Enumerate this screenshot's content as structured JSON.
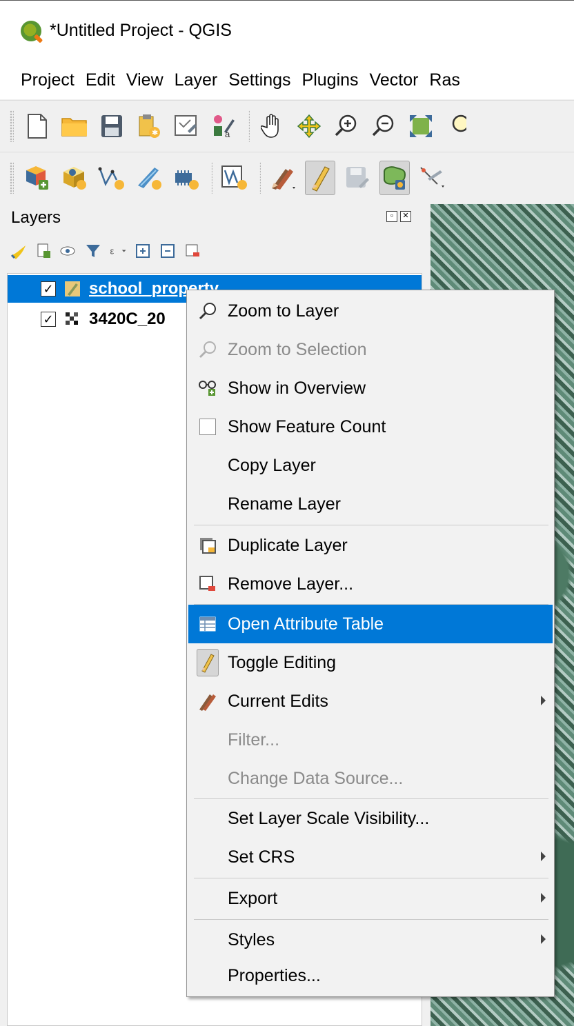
{
  "window": {
    "title": "*Untitled Project - QGIS"
  },
  "menubar": {
    "items": [
      "Project",
      "Edit",
      "View",
      "Layer",
      "Settings",
      "Plugins",
      "Vector",
      "Ras"
    ]
  },
  "layers_panel": {
    "title": "Layers",
    "layers": [
      {
        "name": "school_property",
        "checked": true,
        "selected": true
      },
      {
        "name": "3420C_20",
        "checked": true,
        "selected": false
      }
    ]
  },
  "context_menu": {
    "items": [
      {
        "label": "Zoom to Layer",
        "icon": "magnifier-icon"
      },
      {
        "label": "Zoom to Selection",
        "icon": "magnifier-icon",
        "disabled": true
      },
      {
        "label": "Show in Overview",
        "icon": "overview-glasses-icon"
      },
      {
        "label": "Show Feature Count",
        "icon": "checkbox-icon"
      },
      {
        "label": "Copy Layer"
      },
      {
        "label": "Rename Layer"
      },
      {
        "label": "Duplicate Layer",
        "icon": "duplicate-layer-icon"
      },
      {
        "label": "Remove Layer...",
        "icon": "remove-layer-icon"
      },
      {
        "label": "Open Attribute Table",
        "icon": "attribute-table-icon",
        "highlighted": true
      },
      {
        "label": "Toggle Editing",
        "icon": "pencil-icon"
      },
      {
        "label": "Current Edits",
        "icon": "current-edits-icon",
        "submenu": true
      },
      {
        "label": "Filter...",
        "disabled": true
      },
      {
        "label": "Change Data Source...",
        "disabled": true
      },
      {
        "label": "Set Layer Scale Visibility..."
      },
      {
        "label": "Set CRS",
        "submenu": true
      },
      {
        "label": "Export",
        "submenu": true
      },
      {
        "label": "Styles",
        "submenu": true
      },
      {
        "label": "Properties..."
      }
    ]
  },
  "colors": {
    "selection": "#0078d7",
    "qgis_green": "#589632",
    "qgis_orange": "#ee7913"
  }
}
